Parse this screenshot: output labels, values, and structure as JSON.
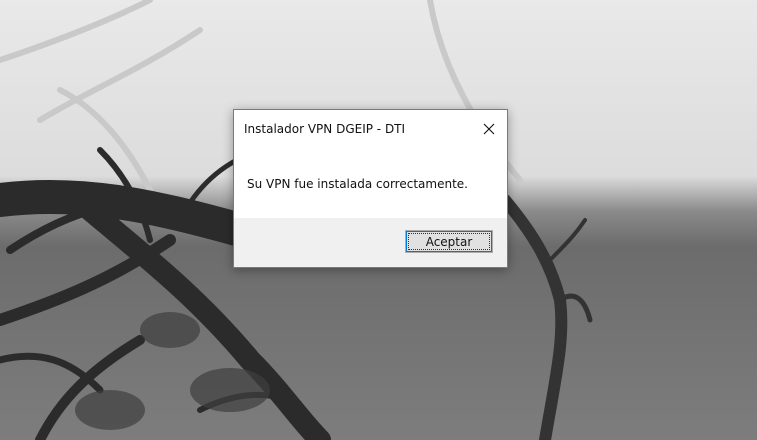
{
  "dialog": {
    "title": "Instalador VPN DGEIP - DTI",
    "close_icon": "close-icon",
    "message": "Su VPN fue instalada correctamente.",
    "ok_label": "Aceptar"
  },
  "colors": {
    "dialog_bg": "#ffffff",
    "button_area_bg": "#f0f0f0",
    "focus_accent": "#0078d7"
  }
}
